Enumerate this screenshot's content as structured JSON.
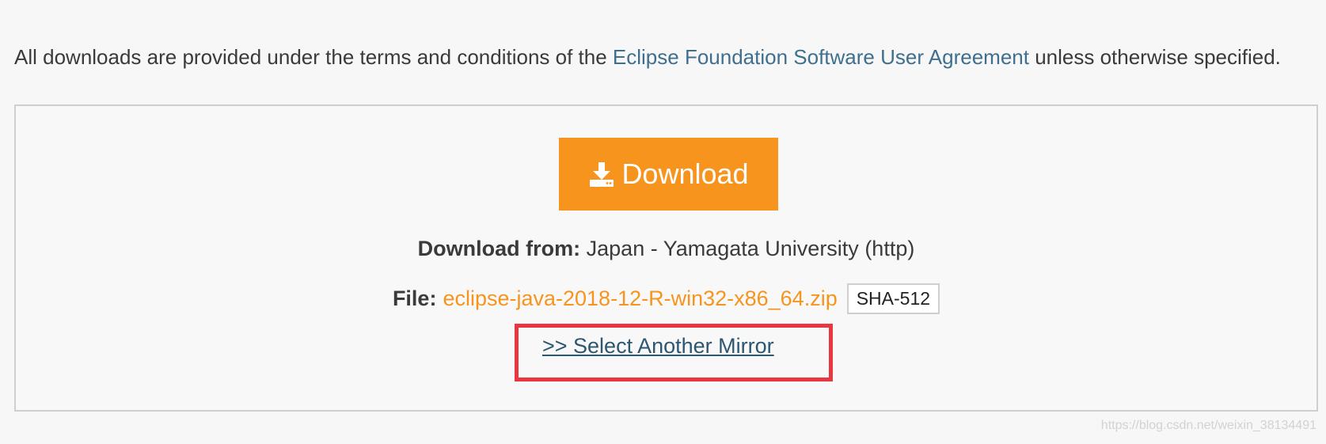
{
  "intro": {
    "prefix": "All downloads are provided under the terms and conditions of the ",
    "link_text": "Eclipse Foundation Software User Agreement",
    "suffix": " unless otherwise specified."
  },
  "download": {
    "button_label": "Download",
    "icon": "download-icon"
  },
  "source": {
    "label": "Download from:",
    "value": "Japan - Yamagata University (http)"
  },
  "file": {
    "label": "File:",
    "name": "eclipse-java-2018-12-R-win32-x86_64.zip",
    "checksum_button": "SHA-512"
  },
  "mirror": {
    "link_text": ">> Select Another Mirror"
  },
  "watermark": "https://blog.csdn.net/weixin_38134491",
  "colors": {
    "accent_orange": "#f7941e",
    "link_blue": "#3f6f8f",
    "highlight_red": "#e8373e"
  }
}
